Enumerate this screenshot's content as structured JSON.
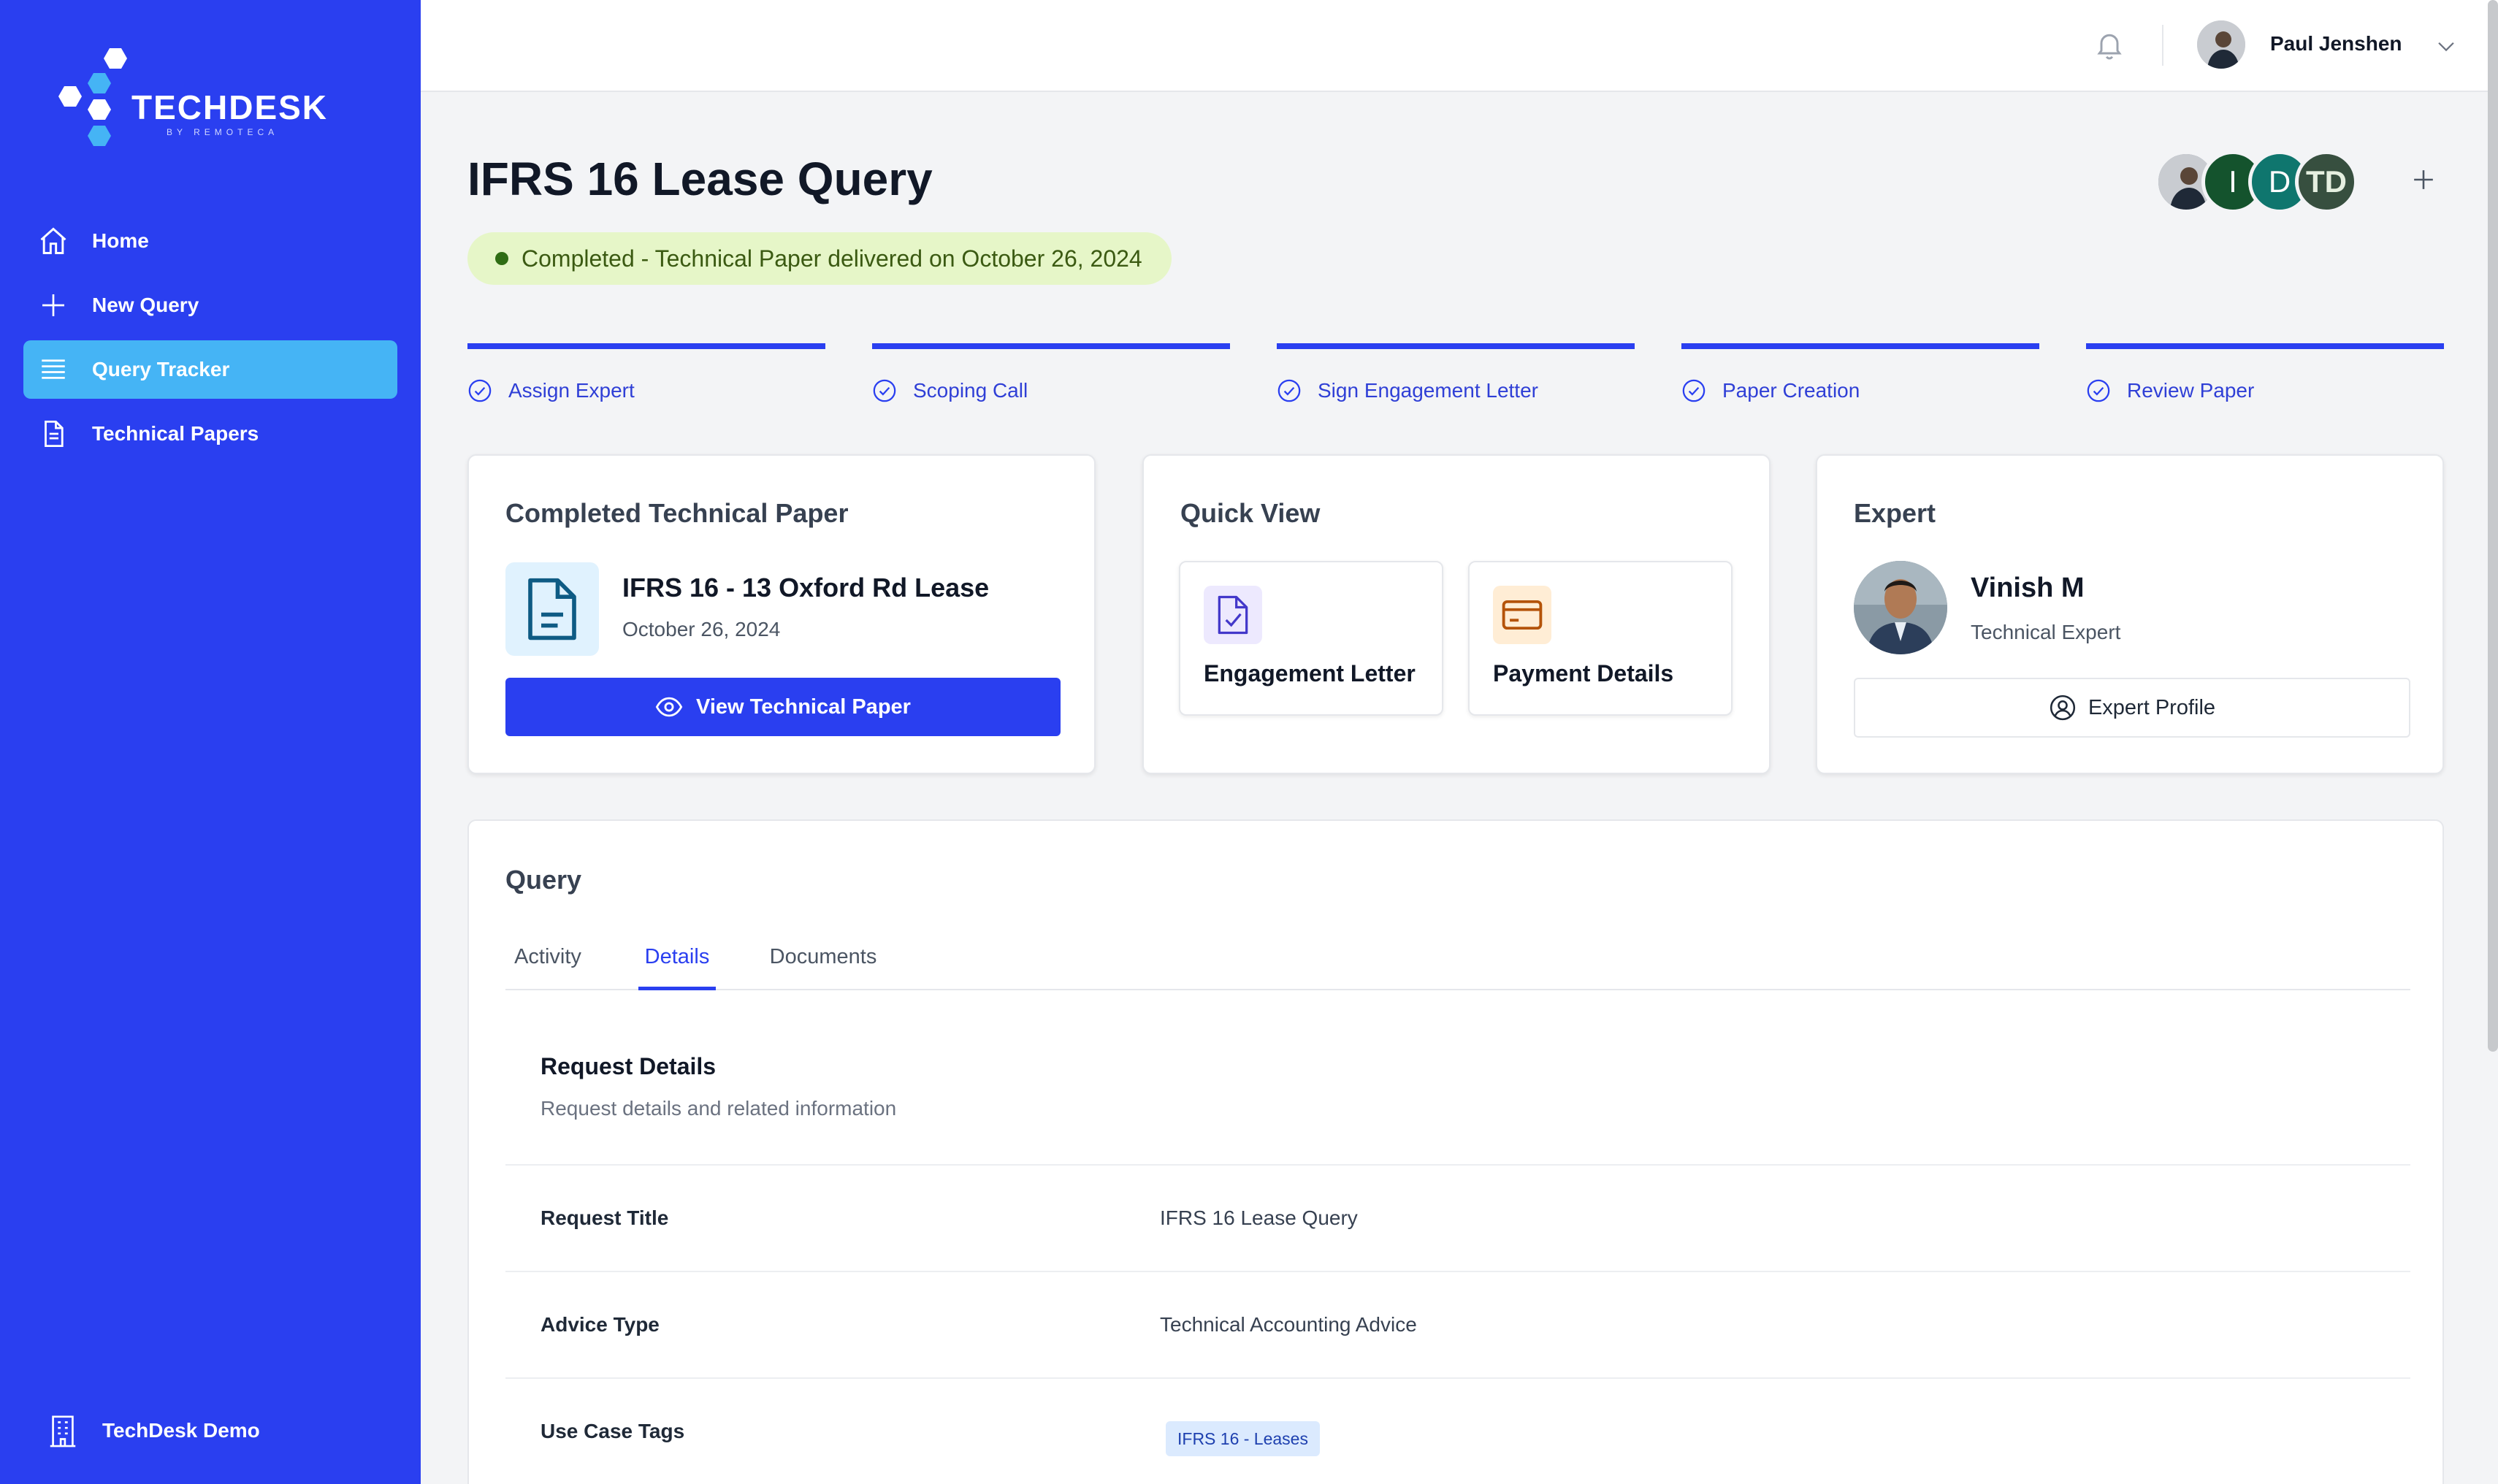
{
  "brand": {
    "name": "TECHDESK",
    "tagline": "BY REMOTECA",
    "primary": "#2a3ff0",
    "active": "#45b4f5"
  },
  "sidebar": {
    "items": [
      {
        "label": "Home",
        "icon": "home-icon",
        "active": false
      },
      {
        "label": "New Query",
        "icon": "plus-icon",
        "active": false
      },
      {
        "label": "Query Tracker",
        "icon": "list-icon",
        "active": true
      },
      {
        "label": "Technical Papers",
        "icon": "document-icon",
        "active": false
      }
    ],
    "org": "TechDesk Demo"
  },
  "header": {
    "user_name": "Paul Jenshen"
  },
  "page": {
    "title": "IFRS 16 Lease Query",
    "status": "Completed - Technical Paper delivered on October 26, 2024",
    "members": [
      {
        "initial": "",
        "color": "#6b7280"
      },
      {
        "initial": "I",
        "color": "#14532d"
      },
      {
        "initial": "D",
        "color": "#0f766e"
      },
      {
        "initial": "TD",
        "color": "#374f3f"
      }
    ]
  },
  "steps": [
    {
      "label": "Assign Expert"
    },
    {
      "label": "Scoping Call"
    },
    {
      "label": "Sign Engagement Letter"
    },
    {
      "label": "Paper Creation"
    },
    {
      "label": "Review Paper"
    }
  ],
  "completed_card": {
    "title": "Completed Technical Paper",
    "paper_name": "IFRS 16 - 13 Oxford Rd Lease",
    "paper_date": "October 26, 2024",
    "button": "View Technical Paper"
  },
  "quick_view": {
    "title": "Quick View",
    "tiles": [
      {
        "label": "Engagement Letter",
        "icon": "signed-document-icon"
      },
      {
        "label": "Payment Details",
        "icon": "credit-card-icon"
      }
    ]
  },
  "expert": {
    "title": "Expert",
    "name": "Vinish M",
    "role": "Technical Expert",
    "button": "Expert Profile"
  },
  "query": {
    "title": "Query",
    "tabs": [
      {
        "label": "Activity",
        "active": false
      },
      {
        "label": "Details",
        "active": true
      },
      {
        "label": "Documents",
        "active": false
      }
    ],
    "section_title": "Request Details",
    "section_subtitle": "Request details and related information",
    "rows": [
      {
        "label": "Request Title",
        "value": "IFRS 16 Lease Query"
      },
      {
        "label": "Advice Type",
        "value": "Technical Accounting Advice"
      },
      {
        "label": "Use Case Tags",
        "tag": "IFRS 16 - Leases"
      }
    ]
  }
}
